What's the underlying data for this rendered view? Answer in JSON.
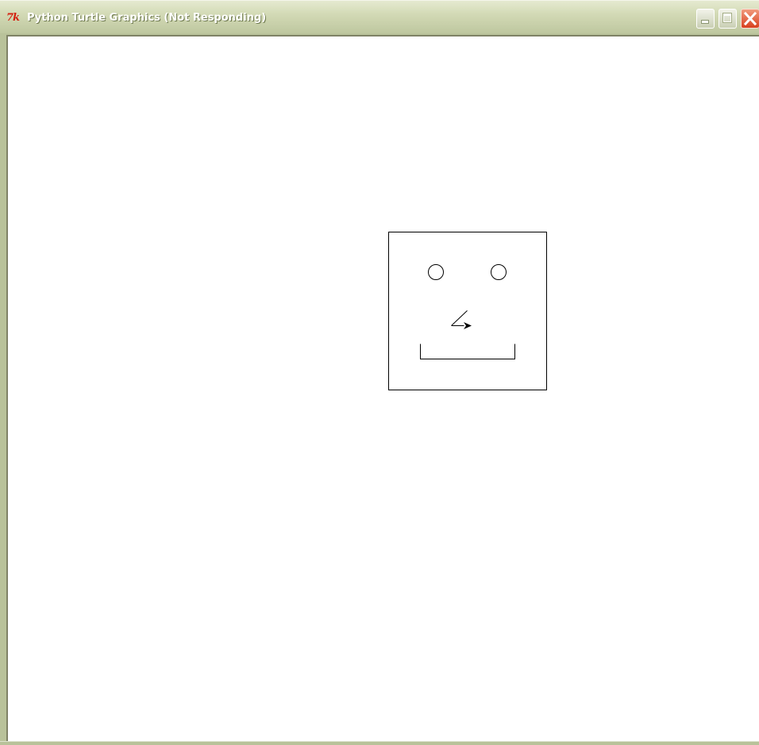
{
  "window": {
    "title": "Python Turtle Graphics (Not Responding)",
    "app_icon_text": "7k",
    "icons": {
      "app": "tk-feather-icon",
      "minimize": "minimize-icon",
      "maximize": "maximize-icon",
      "close": "close-icon"
    },
    "colors": {
      "titlebar": "#d3dab6",
      "frame": "#b9c29a",
      "close_button": "#d8401f",
      "canvas": "#ffffff",
      "ink": "#000000"
    }
  },
  "canvas": {
    "drawing": {
      "shapes": [
        "square-face-outline",
        "left-eye-circle",
        "right-eye-circle",
        "nose-line",
        "mouth-bracket"
      ],
      "turtle_cursor": "arrow"
    }
  }
}
